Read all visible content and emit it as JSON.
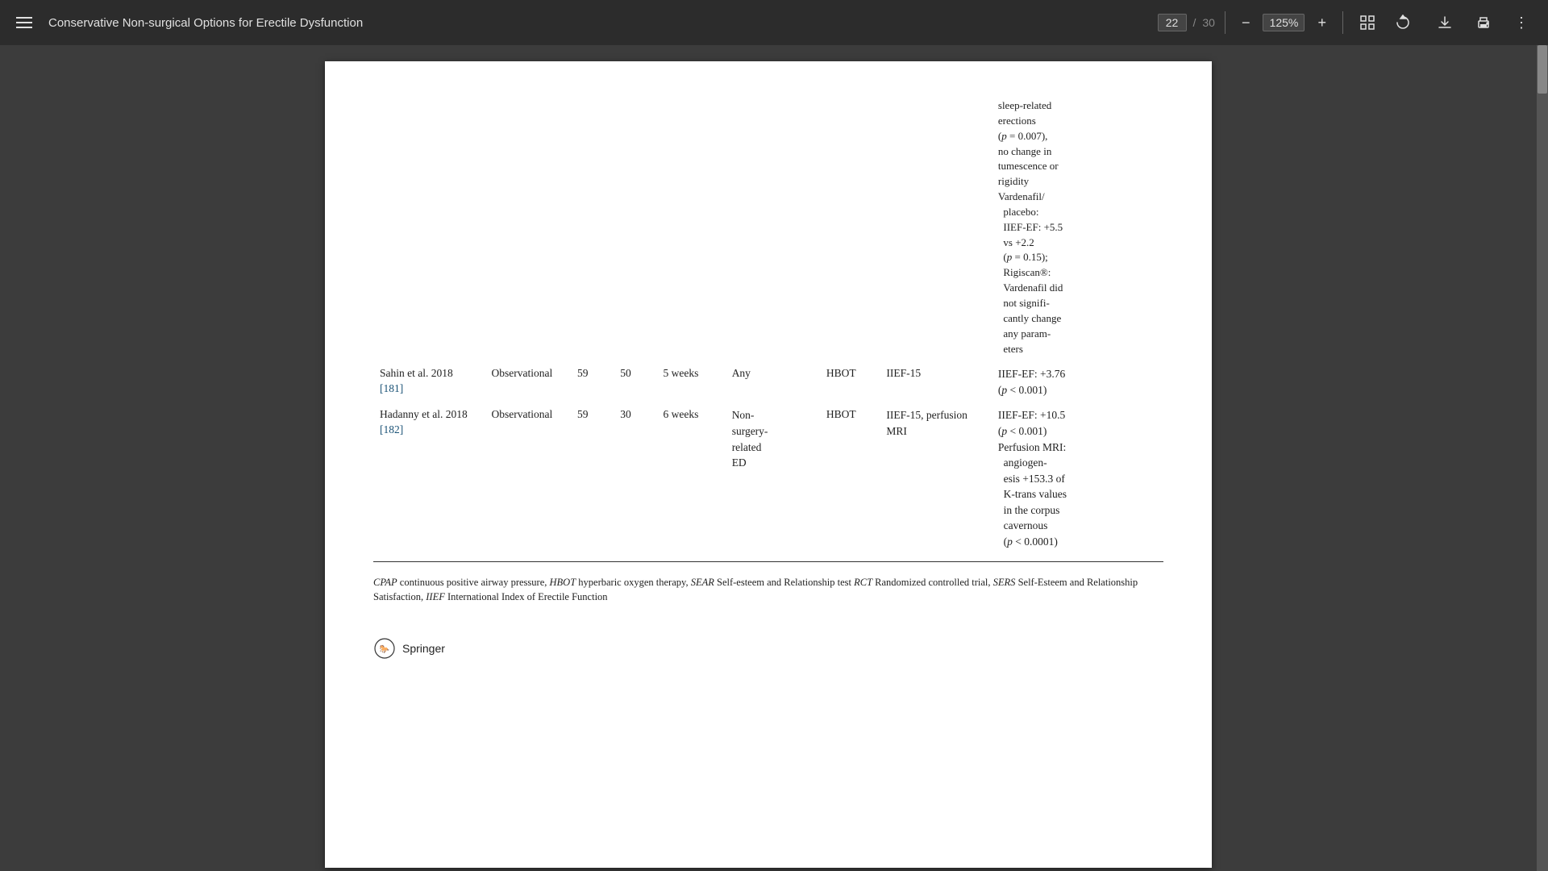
{
  "toolbar": {
    "menu_label": "Menu",
    "title": "Conservative Non-surgical Options for Erectile Dysfunction",
    "page_current": "22",
    "page_total": "30",
    "zoom": "125%",
    "download_label": "Download",
    "print_label": "Print",
    "more_label": "More options",
    "fit_label": "Fit page",
    "rotate_label": "Rotate"
  },
  "page": {
    "above_table": {
      "lines": [
        "sleep-related",
        "erections",
        "(p = 0.007),",
        "no change in",
        "tumescence or",
        "rigidity",
        "Vardenafil/",
        "  placebo:",
        "  IIEF-EF: +5.5",
        "  vs +2.2",
        "  (p = 0.15);",
        "  Rigiscan®:",
        "  Vardenafil did",
        "  not signifi-",
        "  cantly change",
        "  any param-",
        "  eters"
      ]
    },
    "table_rows": [
      {
        "author": "Sahin et al. 2018",
        "ref": "181",
        "study_type": "Observational",
        "n": "59",
        "age": "50",
        "duration": "5 weeks",
        "etiology": "Any",
        "treatment": "HBOT",
        "outcome": "IIEF-15",
        "results": "IIEF-EF: +3.76 (p < 0.001)"
      },
      {
        "author": "Hadanny et al. 2018",
        "ref": "182",
        "study_type": "Observational",
        "n": "59",
        "age": "30",
        "duration": "6 weeks",
        "etiology": "Non-surgery-related ED",
        "treatment": "HBOT",
        "outcome": "IIEF-15, perfusion MRI",
        "results": "IIEF-EF: +10.5 (p < 0.001) Perfusion MRI: angiogenesis +153.3 of K-trans values in the corpus cavernous (p < 0.0001)"
      }
    ],
    "footnote": {
      "text": "CPAP continuous positive airway pressure, HBOT hyperbaric oxygen therapy, SEAR Self-esteem and Relationship test RCT Randomized controlled trial, SERS Self-Esteem and Relationship Satisfaction, IIEF International Index of Erectile Function"
    },
    "springer": {
      "name": "Springer"
    }
  }
}
